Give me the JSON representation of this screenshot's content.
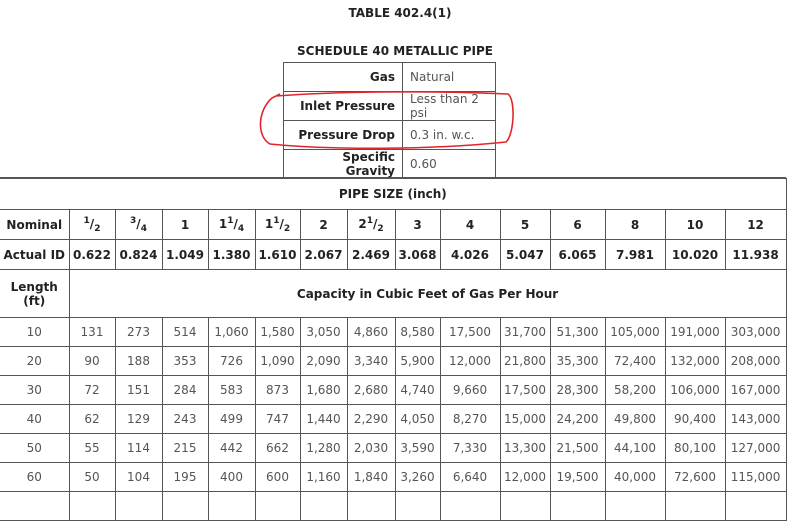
{
  "title": "TABLE 402.4(1)",
  "subtitle": "SCHEDULE 40 METALLIC PIPE",
  "meta": [
    {
      "label": "Gas",
      "value": "Natural"
    },
    {
      "label": "Inlet Pressure",
      "value": "Less than 2 psi"
    },
    {
      "label": "Pressure Drop",
      "value": "0.3 in. w.c."
    },
    {
      "label": "Specific Gravity",
      "value": "0.60"
    }
  ],
  "annotation": {
    "color": "#e0262b",
    "note": "Inlet Pressure and Pressure Drop rows circled in red"
  },
  "pipe_size_header": "PIPE SIZE (inch)",
  "nominal_label": "Nominal",
  "nominal": [
    {
      "w": "",
      "n": "1",
      "d": "2"
    },
    {
      "w": "",
      "n": "3",
      "d": "4"
    },
    {
      "w": "1",
      "n": "",
      "d": ""
    },
    {
      "w": "1",
      "n": "1",
      "d": "4"
    },
    {
      "w": "1",
      "n": "1",
      "d": "2"
    },
    {
      "w": "2",
      "n": "",
      "d": ""
    },
    {
      "w": "2",
      "n": "1",
      "d": "2"
    },
    {
      "w": "3",
      "n": "",
      "d": ""
    },
    {
      "w": "4",
      "n": "",
      "d": ""
    },
    {
      "w": "5",
      "n": "",
      "d": ""
    },
    {
      "w": "6",
      "n": "",
      "d": ""
    },
    {
      "w": "8",
      "n": "",
      "d": ""
    },
    {
      "w": "10",
      "n": "",
      "d": ""
    },
    {
      "w": "12",
      "n": "",
      "d": ""
    }
  ],
  "actual_id_label": "Actual ID",
  "actual_id": [
    "0.622",
    "0.824",
    "1.049",
    "1.380",
    "1.610",
    "2.067",
    "2.469",
    "3.068",
    "4.026",
    "5.047",
    "6.065",
    "7.981",
    "10.020",
    "11.938"
  ],
  "length_label": "Length (ft)",
  "capacity_header": "Capacity in Cubic Feet of Gas Per Hour",
  "rows": [
    {
      "length": "10",
      "values": [
        "131",
        "273",
        "514",
        "1,060",
        "1,580",
        "3,050",
        "4,860",
        "8,580",
        "17,500",
        "31,700",
        "51,300",
        "105,000",
        "191,000",
        "303,000"
      ]
    },
    {
      "length": "20",
      "values": [
        "90",
        "188",
        "353",
        "726",
        "1,090",
        "2,090",
        "3,340",
        "5,900",
        "12,000",
        "21,800",
        "35,300",
        "72,400",
        "132,000",
        "208,000"
      ]
    },
    {
      "length": "30",
      "values": [
        "72",
        "151",
        "284",
        "583",
        "873",
        "1,680",
        "2,680",
        "4,740",
        "9,660",
        "17,500",
        "28,300",
        "58,200",
        "106,000",
        "167,000"
      ]
    },
    {
      "length": "40",
      "values": [
        "62",
        "129",
        "243",
        "499",
        "747",
        "1,440",
        "2,290",
        "4,050",
        "8,270",
        "15,000",
        "24,200",
        "49,800",
        "90,400",
        "143,000"
      ]
    },
    {
      "length": "50",
      "values": [
        "55",
        "114",
        "215",
        "442",
        "662",
        "1,280",
        "2,030",
        "3,590",
        "7,330",
        "13,300",
        "21,500",
        "44,100",
        "80,100",
        "127,000"
      ]
    },
    {
      "length": "60",
      "values": [
        "50",
        "104",
        "195",
        "400",
        "600",
        "1,160",
        "1,840",
        "3,260",
        "6,640",
        "12,000",
        "19,500",
        "40,000",
        "72,600",
        "115,000"
      ]
    }
  ]
}
